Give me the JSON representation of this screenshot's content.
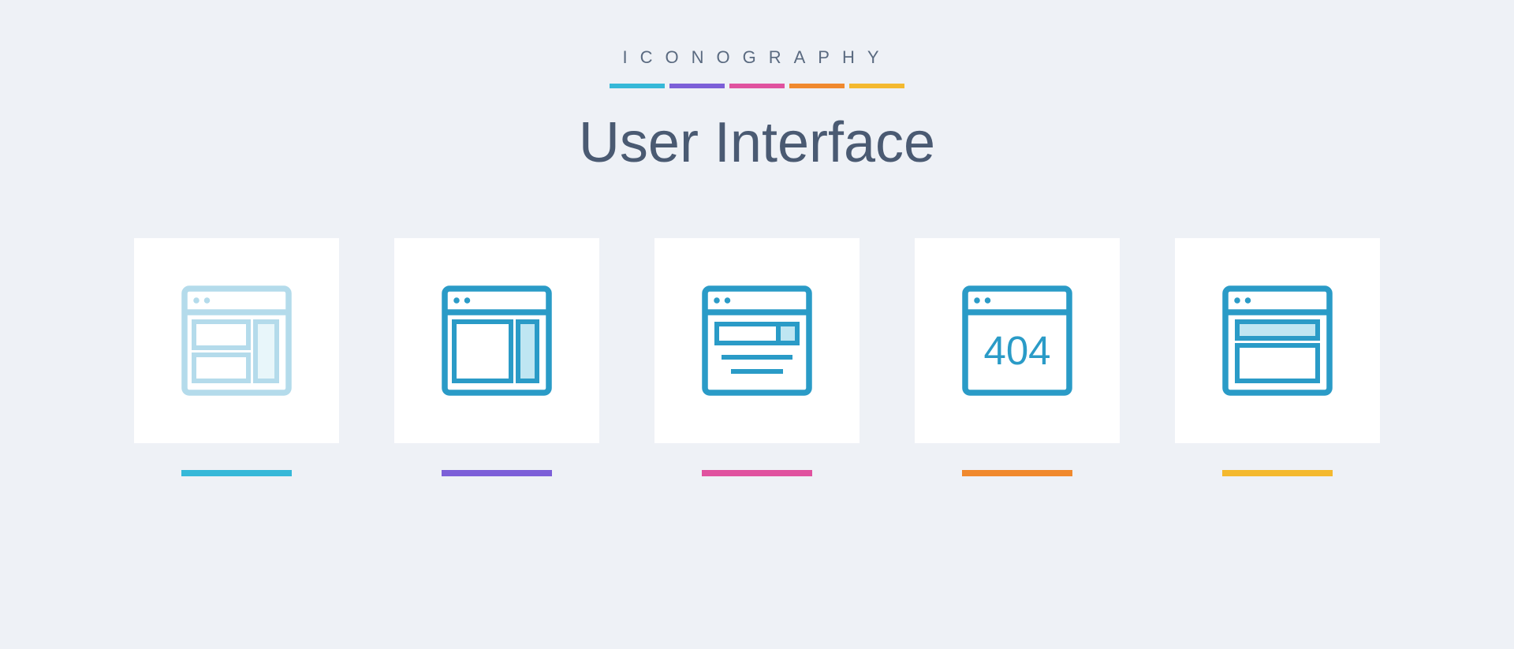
{
  "header": {
    "overline": "ICONOGRAPHY",
    "title": "User Interface"
  },
  "colors": {
    "cyan": "#36b8d8",
    "purple": "#7c5fd8",
    "pink": "#e0529f",
    "orange": "#f0892e",
    "yellow": "#f4b92f"
  },
  "icons": [
    {
      "name": "layout-content-sidebar-icon",
      "underbar": "cyan",
      "faded": true
    },
    {
      "name": "layout-main-sidebar-icon",
      "underbar": "purple",
      "faded": false
    },
    {
      "name": "search-page-icon",
      "underbar": "pink",
      "faded": false
    },
    {
      "name": "error-404-icon",
      "underbar": "orange",
      "faded": false
    },
    {
      "name": "layout-header-body-icon",
      "underbar": "yellow",
      "faded": false
    }
  ],
  "error_text": "404"
}
